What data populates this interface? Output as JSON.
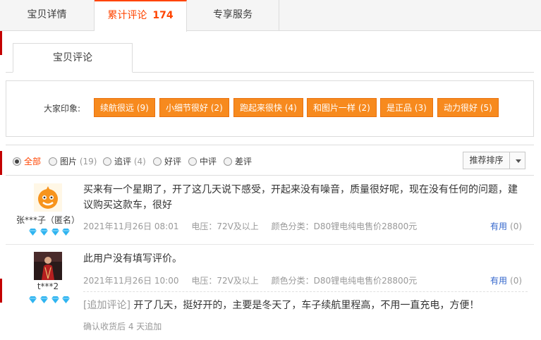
{
  "tabs": {
    "detail": "宝贝详情",
    "reviews": "累计评论",
    "reviews_count": "174",
    "service": "专享服务"
  },
  "subtab": {
    "label": "宝贝评论"
  },
  "impressions": {
    "label": "大家印象:",
    "tags": [
      "续航很远 (9)",
      "小细节很好 (2)",
      "跑起来很快 (4)",
      "和图片一样 (2)",
      "是正品 (3)",
      "动力很好 (5)"
    ]
  },
  "filter": {
    "all": "全部",
    "images": "图片",
    "images_count": "(19)",
    "followup": "追评",
    "followup_count": "(4)",
    "positive": "好评",
    "neutral": "中评",
    "negative": "差评",
    "sort_label": "推荐排序"
  },
  "reviews": [
    {
      "user": "张***子（匿名）",
      "text": "买来有一个星期了，开了这几天说下感受，开起来没有噪音，质量很好呢，现在没有任何的问题，建议购买这款车，很好",
      "date": "2021年11月26日 08:01",
      "voltage": "电压：72V及以上",
      "color": "颜色分类：D80锂电纯电售价28800元",
      "useful": "有用",
      "useful_count": "(0)"
    },
    {
      "user": "t***2",
      "text": "此用户没有填写评价。",
      "date": "2021年11月26日 10:00",
      "voltage": "电压：72V及以上",
      "color": "颜色分类：D80锂电纯电售价28800元",
      "useful": "有用",
      "useful_count": "(0)",
      "append_tag": "[追加评论]",
      "append_text": "开了几天，挺好开的，主要是冬天了，车子续航里程高，不用一直充电，方便！",
      "append_date": "确认收货后 4 天追加"
    }
  ],
  "colors": {
    "accent": "#ff4400",
    "tag_bg": "#f78a1e",
    "link": "#3366cc",
    "gem": "#2fb4f0"
  }
}
